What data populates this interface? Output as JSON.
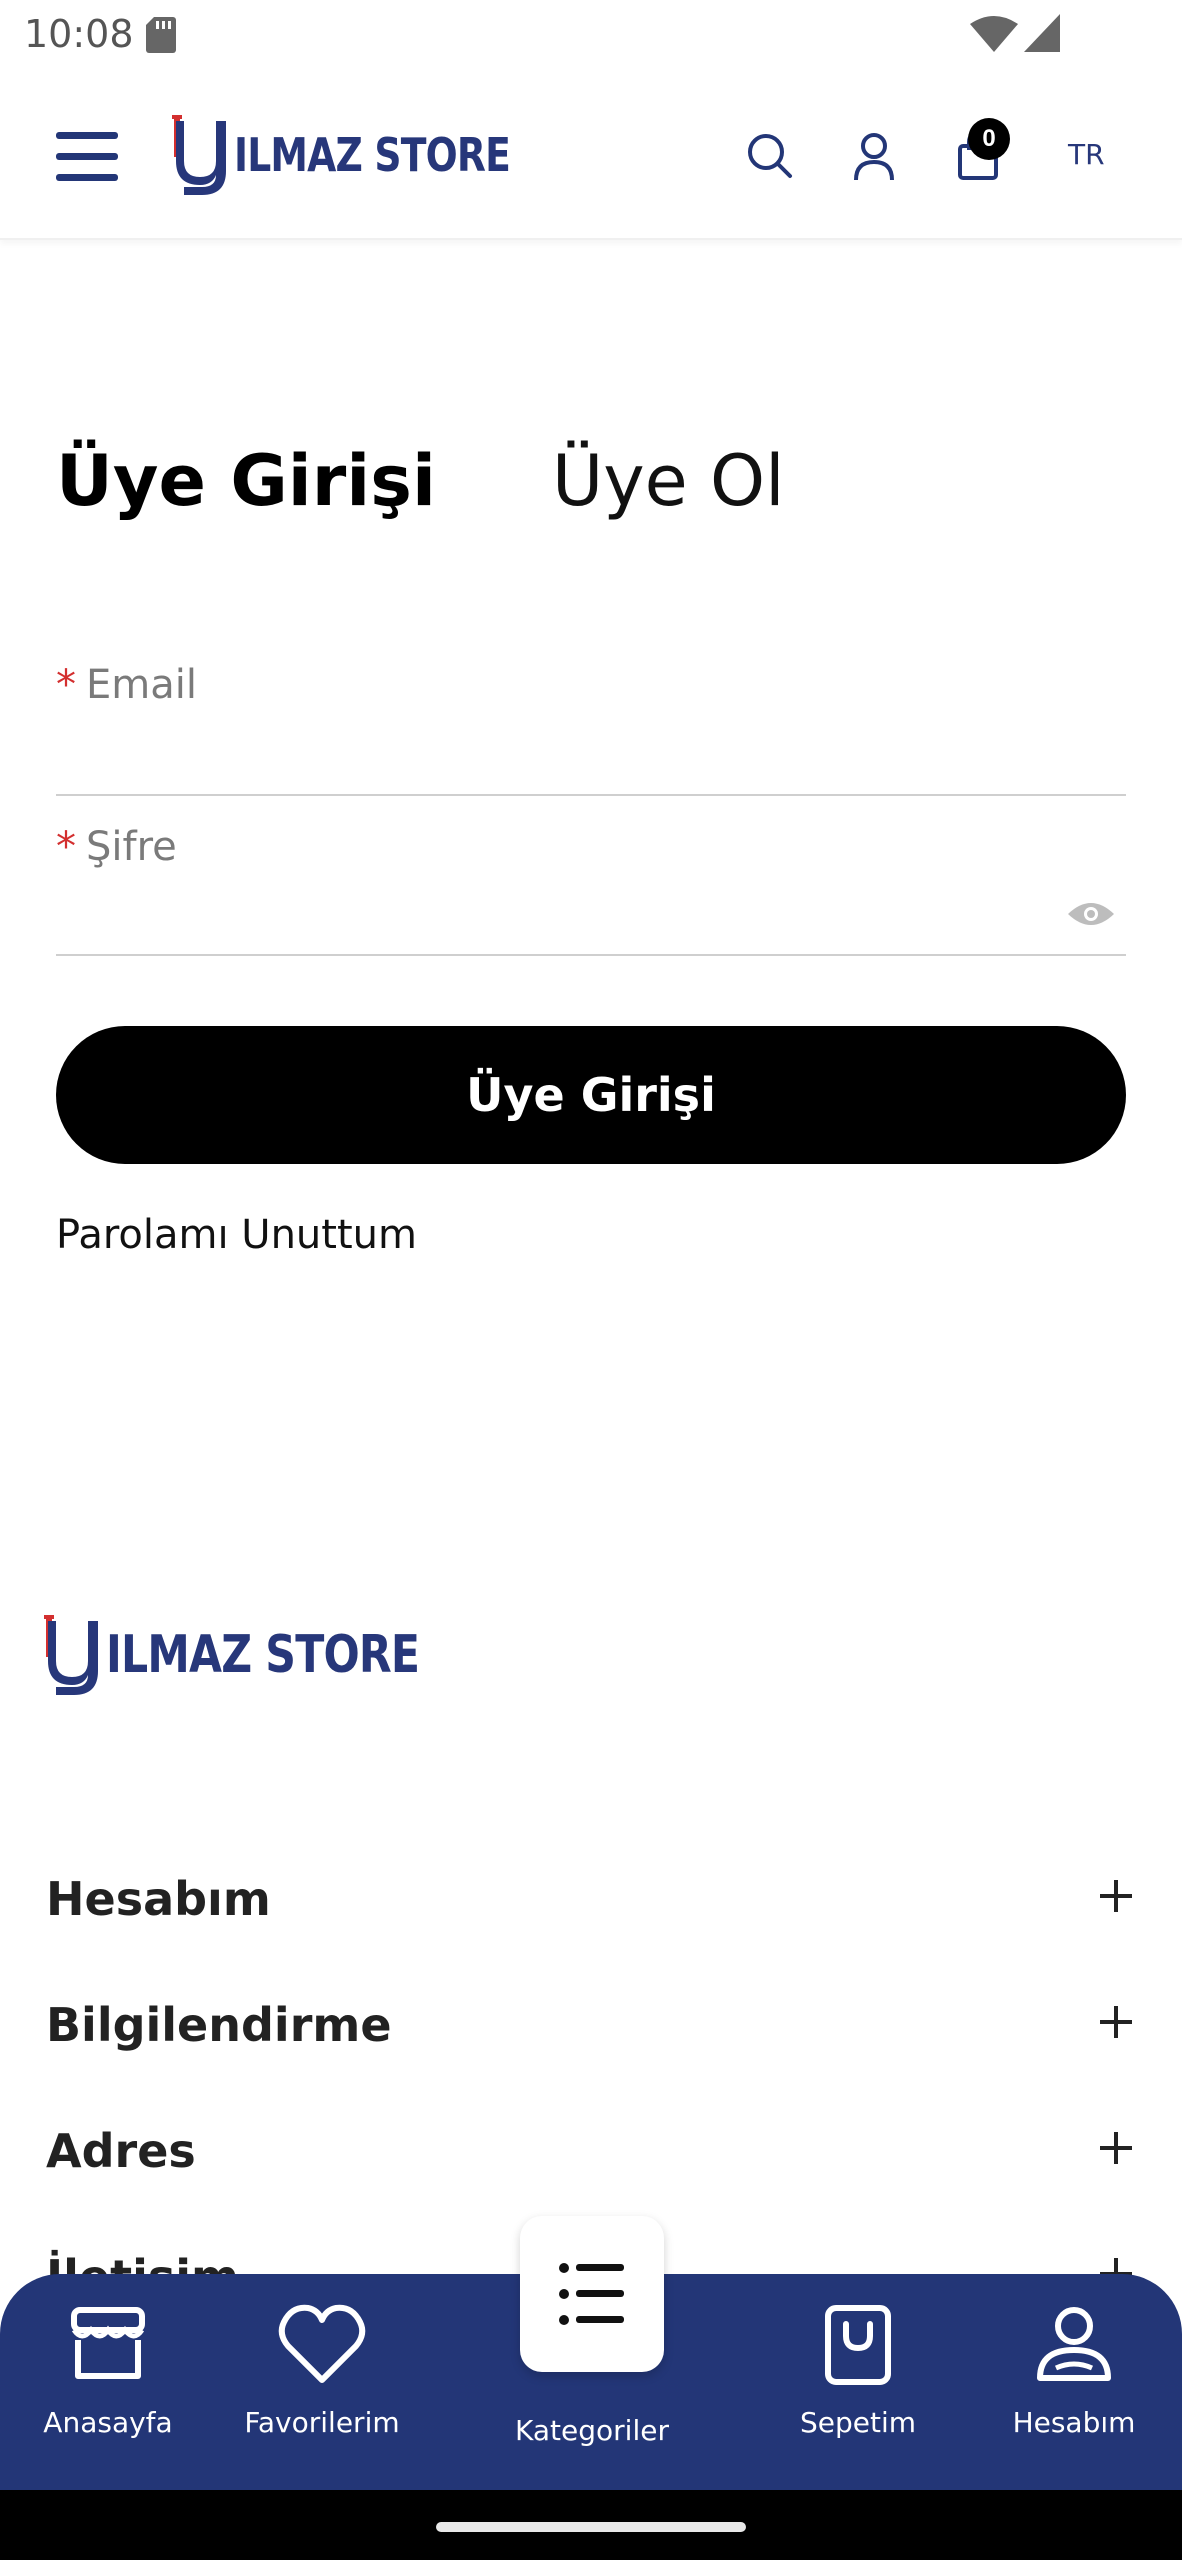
{
  "status_bar": {
    "time": "10:08"
  },
  "header": {
    "logo_text": "ILMAZ STORE",
    "cart_count": "0",
    "language": "TR"
  },
  "tabs": {
    "login": "Üye Girişi",
    "register": "Üye Ol"
  },
  "form": {
    "email_label": "Email",
    "password_label": "Şifre",
    "required_marker": "*",
    "submit_label": "Üye Girişi",
    "forgot_label": "Parolamı Unuttum"
  },
  "footer": {
    "logo_text": "ILMAZ STORE",
    "sections": [
      "Hesabım",
      "Bilgilendirme",
      "Adres",
      "İletişim"
    ]
  },
  "bottom_nav": {
    "items": [
      "Anasayfa",
      "Favorilerim",
      "Kategoriler",
      "Sepetim",
      "Hesabım"
    ]
  },
  "colors": {
    "brand_navy": "#233677",
    "logo_red": "#d32f2f",
    "button_black": "#000000"
  },
  "icons": [
    "menu-icon",
    "search-icon",
    "user-icon",
    "cart-icon",
    "eye-icon",
    "plus-icon",
    "store-icon",
    "heart-icon",
    "list-icon",
    "shopping-bag-icon",
    "account-icon"
  ]
}
